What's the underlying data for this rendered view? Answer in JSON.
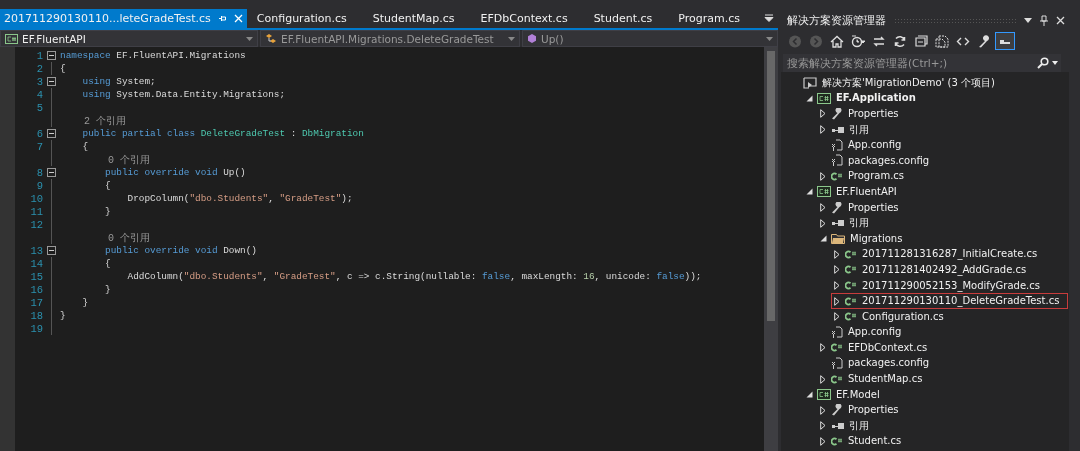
{
  "editor": {
    "tabs": [
      {
        "label": "201711290130110...leteGradeTest.cs",
        "selected": true
      },
      {
        "label": "Configuration.cs",
        "selected": false
      },
      {
        "label": "StudentMap.cs",
        "selected": false
      },
      {
        "label": "EFDbContext.cs",
        "selected": false
      },
      {
        "label": "Student.cs",
        "selected": false
      },
      {
        "label": "Program.cs",
        "selected": false
      }
    ],
    "nav": {
      "project": "EF.FluentAPI",
      "type": "EF.FluentAPI.Migrations.DeleteGradeTest",
      "member": "Up()"
    },
    "lines": [
      {
        "kind": "code",
        "number": "1",
        "fold": true,
        "tokens": [
          {
            "kind": "kw",
            "text": "namespace"
          },
          {
            "kind": "plain",
            "text": " EF.FluentAPI.Migrations"
          }
        ]
      },
      {
        "kind": "code",
        "number": "2",
        "fold": false,
        "tokens": [
          {
            "kind": "plain",
            "text": "{"
          }
        ]
      },
      {
        "kind": "code",
        "number": "3",
        "fold": true,
        "tokens": [
          {
            "kind": "kw",
            "text": "    using"
          },
          {
            "kind": "plain",
            "text": " System;"
          }
        ]
      },
      {
        "kind": "code",
        "number": "4",
        "fold": false,
        "tokens": [
          {
            "kind": "kw",
            "text": "    using"
          },
          {
            "kind": "plain",
            "text": " System.Data.Entity.Migrations;"
          }
        ]
      },
      {
        "kind": "code",
        "number": "5",
        "fold": false
      },
      {
        "kind": "lens",
        "text": "    2 个引用"
      },
      {
        "kind": "code",
        "number": "6",
        "fold": true,
        "tokens": [
          {
            "kind": "kw",
            "text": "    public partial class"
          },
          {
            "kind": "type",
            "text": " DeleteGradeTest"
          },
          {
            "kind": "plain",
            "text": " : "
          },
          {
            "kind": "type",
            "text": "DbMigration"
          }
        ]
      },
      {
        "kind": "code",
        "number": "7",
        "fold": false,
        "tokens": [
          {
            "kind": "plain",
            "text": "    {"
          }
        ]
      },
      {
        "kind": "lens",
        "text": "        0 个引用"
      },
      {
        "kind": "code",
        "number": "8",
        "fold": true,
        "tokens": [
          {
            "kind": "kw",
            "text": "        public override void"
          },
          {
            "kind": "plain",
            "text": " Up()"
          }
        ]
      },
      {
        "kind": "code",
        "number": "9",
        "fold": false,
        "tokens": [
          {
            "kind": "plain",
            "text": "        {"
          }
        ]
      },
      {
        "kind": "code",
        "number": "10",
        "fold": false,
        "tokens": [
          {
            "kind": "plain",
            "text": "            DropColumn("
          },
          {
            "kind": "str",
            "text": "\"dbo.Students\""
          },
          {
            "kind": "plain",
            "text": ", "
          },
          {
            "kind": "str",
            "text": "\"GradeTest\""
          },
          {
            "kind": "plain",
            "text": ");"
          }
        ]
      },
      {
        "kind": "code",
        "number": "11",
        "fold": false,
        "tokens": [
          {
            "kind": "plain",
            "text": "        }"
          }
        ]
      },
      {
        "kind": "code",
        "number": "12",
        "fold": false
      },
      {
        "kind": "lens",
        "text": "        0 个引用"
      },
      {
        "kind": "code",
        "number": "13",
        "fold": true,
        "tokens": [
          {
            "kind": "kw",
            "text": "        public override void"
          },
          {
            "kind": "plain",
            "text": " Down()"
          }
        ]
      },
      {
        "kind": "code",
        "number": "14",
        "fold": false,
        "tokens": [
          {
            "kind": "plain",
            "text": "        {"
          }
        ]
      },
      {
        "kind": "code",
        "number": "15",
        "fold": false,
        "tokens": [
          {
            "kind": "plain",
            "text": "            AddColumn("
          },
          {
            "kind": "str",
            "text": "\"dbo.Students\""
          },
          {
            "kind": "plain",
            "text": ", "
          },
          {
            "kind": "str",
            "text": "\"GradeTest\""
          },
          {
            "kind": "plain",
            "text": ", c => c.String(nullable: "
          },
          {
            "kind": "kw",
            "text": "false"
          },
          {
            "kind": "plain",
            "text": ", maxLength: "
          },
          {
            "kind": "num",
            "text": "16"
          },
          {
            "kind": "plain",
            "text": ", unicode: "
          },
          {
            "kind": "kw",
            "text": "false"
          },
          {
            "kind": "plain",
            "text": "));"
          }
        ]
      },
      {
        "kind": "code",
        "number": "16",
        "fold": false,
        "tokens": [
          {
            "kind": "plain",
            "text": "        }"
          }
        ]
      },
      {
        "kind": "code",
        "number": "17",
        "fold": false,
        "tokens": [
          {
            "kind": "plain",
            "text": "    }"
          }
        ]
      },
      {
        "kind": "code",
        "number": "18",
        "fold": false,
        "tokens": [
          {
            "kind": "plain",
            "text": "}"
          }
        ]
      },
      {
        "kind": "code",
        "number": "19",
        "fold": false
      }
    ]
  },
  "explorer": {
    "title": "解决方案资源管理器",
    "toolbar": [
      {
        "kind": "back",
        "on": false,
        "disabled": true
      },
      {
        "kind": "forward",
        "on": false,
        "disabled": true
      },
      {
        "kind": "home",
        "on": false,
        "disabled": false
      },
      {
        "kind": "history",
        "on": false,
        "disabled": false
      },
      {
        "kind": "sync",
        "on": false,
        "disabled": false
      },
      {
        "kind": "refresh",
        "on": false,
        "disabled": false
      },
      {
        "kind": "collapse",
        "on": false,
        "disabled": false
      },
      {
        "kind": "showall",
        "on": false,
        "disabled": false
      },
      {
        "kind": "code",
        "on": false,
        "disabled": false
      },
      {
        "kind": "properties",
        "on": false,
        "disabled": false
      },
      {
        "kind": "preview",
        "on": true,
        "disabled": false
      }
    ],
    "search": {
      "placeholder": "搜索解决方案资源管理器(Ctrl+;)"
    },
    "tree": [
      {
        "label": "解决方案'MigrationDemo' (3 个项目)",
        "kind": "solution",
        "selected": false,
        "children": [
          {
            "label": "EF.Application",
            "kind": "project",
            "startup": true,
            "expanded": true,
            "selected": false,
            "children": [
              {
                "label": "Properties",
                "kind": "props",
                "expanded": false,
                "selected": false
              },
              {
                "label": "引用",
                "kind": "refs",
                "expanded": false,
                "selected": false
              },
              {
                "label": "App.config",
                "kind": "config",
                "selected": false
              },
              {
                "label": "packages.config",
                "kind": "config",
                "selected": false
              },
              {
                "label": "Program.cs",
                "kind": "cs",
                "expanded": false,
                "selected": false
              }
            ]
          },
          {
            "label": "EF.FluentAPI",
            "kind": "project",
            "startup": false,
            "expanded": true,
            "selected": false,
            "children": [
              {
                "label": "Properties",
                "kind": "props",
                "expanded": false,
                "selected": false
              },
              {
                "label": "引用",
                "kind": "refs",
                "expanded": false,
                "selected": false
              },
              {
                "label": "Migrations",
                "kind": "folder",
                "expanded": true,
                "selected": false,
                "children": [
                  {
                    "label": "201711281316287_InitialCreate.cs",
                    "kind": "cs",
                    "expanded": false,
                    "selected": false
                  },
                  {
                    "label": "201711281402492_AddGrade.cs",
                    "kind": "cs",
                    "expanded": false,
                    "selected": false
                  },
                  {
                    "label": "201711290052153_ModifyGrade.cs",
                    "kind": "cs",
                    "expanded": false,
                    "selected": false
                  },
                  {
                    "label": "201711290130110_DeleteGradeTest.cs",
                    "kind": "cs",
                    "expanded": false,
                    "selected": true
                  },
                  {
                    "label": "Configuration.cs",
                    "kind": "cs",
                    "expanded": false,
                    "selected": false
                  }
                ]
              },
              {
                "label": "App.config",
                "kind": "config",
                "selected": false
              },
              {
                "label": "EFDbContext.cs",
                "kind": "cs",
                "expanded": false,
                "selected": false
              },
              {
                "label": "packages.config",
                "kind": "config",
                "selected": false
              },
              {
                "label": "StudentMap.cs",
                "kind": "cs",
                "expanded": false,
                "selected": false
              }
            ]
          },
          {
            "label": "EF.Model",
            "kind": "project",
            "startup": false,
            "expanded": true,
            "selected": false,
            "children": [
              {
                "label": "Properties",
                "kind": "props",
                "expanded": false,
                "selected": false
              },
              {
                "label": "引用",
                "kind": "refs",
                "expanded": false,
                "selected": false
              },
              {
                "label": "Student.cs",
                "kind": "cs",
                "expanded": false,
                "selected": false
              }
            ]
          }
        ]
      }
    ]
  }
}
